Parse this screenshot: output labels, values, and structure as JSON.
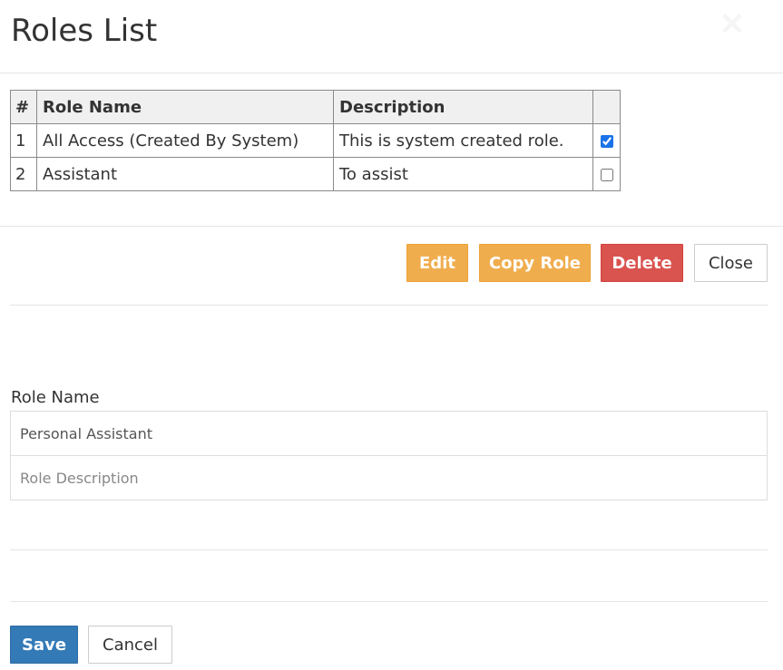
{
  "modal": {
    "title": "Roles List",
    "close_glyph": "✕"
  },
  "table": {
    "headers": [
      "#",
      "Role Name",
      "Description",
      ""
    ],
    "rows": [
      {
        "num": "1",
        "name": "All Access (Created By System)",
        "description": "This is system created role.",
        "checked": true
      },
      {
        "num": "2",
        "name": "Assistant",
        "description": "To assist",
        "checked": false
      }
    ]
  },
  "actions": {
    "edit_label": "Edit",
    "copy_label": "Copy Role",
    "delete_label": "Delete",
    "close_label": "Close"
  },
  "form": {
    "role_name_label": "Role Name",
    "role_name_value": "Personal Assistant",
    "role_description_value": "",
    "role_description_placeholder": "Role Description"
  },
  "footer": {
    "save_label": "Save",
    "cancel_label": "Cancel"
  },
  "colors": {
    "warning": "#f0ad4e",
    "danger": "#d9534f",
    "primary": "#337ab7",
    "checkbox_accent": "#1a73e8"
  }
}
